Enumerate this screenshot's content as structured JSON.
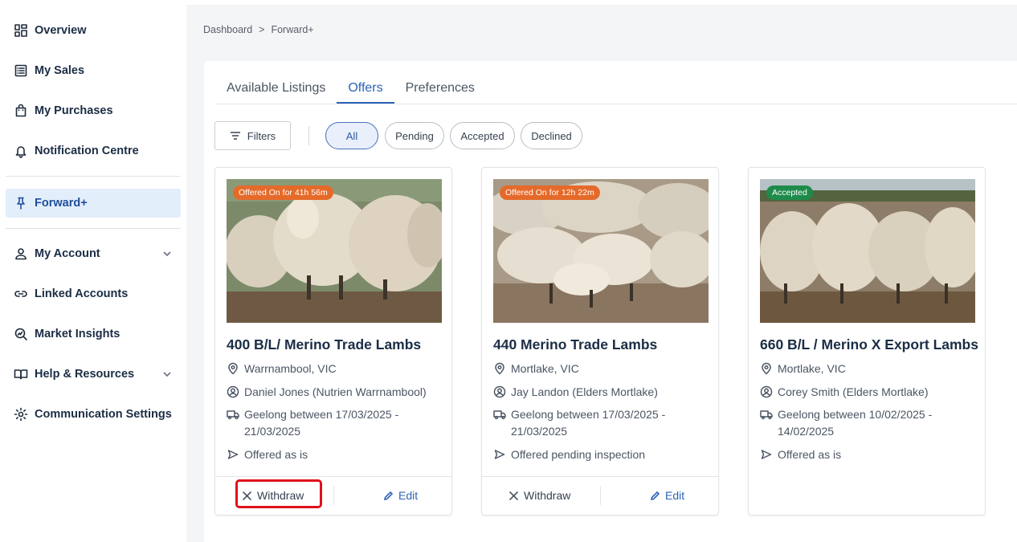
{
  "sidebar": {
    "items": [
      {
        "label": "Overview",
        "icon": "grid-icon"
      },
      {
        "label": "My Sales",
        "icon": "list-icon"
      },
      {
        "label": "My Purchases",
        "icon": "bag-icon"
      },
      {
        "label": "Notification Centre",
        "icon": "bell-icon"
      },
      {
        "label": "Forward+",
        "icon": "pin-icon",
        "active": true
      },
      {
        "label": "My Account",
        "icon": "user-icon",
        "expandable": true
      },
      {
        "label": "Linked Accounts",
        "icon": "link-icon"
      },
      {
        "label": "Market Insights",
        "icon": "insights-icon"
      },
      {
        "label": "Help & Resources",
        "icon": "book-icon",
        "expandable": true
      },
      {
        "label": "Communication Settings",
        "icon": "gear-icon"
      }
    ]
  },
  "breadcrumb": {
    "home": "Dashboard",
    "separator": ">",
    "current": "Forward+"
  },
  "tabs": [
    {
      "label": "Available Listings"
    },
    {
      "label": "Offers",
      "active": true
    },
    {
      "label": "Preferences"
    }
  ],
  "filters": {
    "button_label": "Filters",
    "chips": [
      {
        "label": "All",
        "active": true
      },
      {
        "label": "Pending"
      },
      {
        "label": "Accepted"
      },
      {
        "label": "Declined"
      }
    ]
  },
  "cards": [
    {
      "badge": "Offered On for 41h 56m",
      "badge_color": "#e56a2a",
      "title": "400 B/L/ Merino Trade Lambs",
      "location": "Warrnambool, VIC",
      "agent": "Daniel Jones (Nutrien Warrnambool)",
      "delivery_line1": "Geelong between 17/03/2025 -",
      "delivery_line2": "21/03/2025",
      "terms": "Offered as is",
      "withdraw_label": "Withdraw",
      "edit_label": "Edit"
    },
    {
      "badge": "Offered On for 12h 22m",
      "badge_color": "#e56a2a",
      "title": "440 Merino Trade Lambs",
      "location": "Mortlake, VIC",
      "agent": "Jay Landon (Elders Mortlake)",
      "delivery_line1": "Geelong between 17/03/2025 -",
      "delivery_line2": "21/03/2025",
      "terms": "Offered pending inspection",
      "withdraw_label": "Withdraw",
      "edit_label": "Edit"
    },
    {
      "badge": "Accepted",
      "badge_color": "#1e8b4a",
      "title": "660 B/L / Merino X Export Lambs",
      "location": "Mortlake, VIC",
      "agent": "Corey Smith (Elders Mortlake)",
      "delivery_line1": "Geelong between 10/02/2025 -",
      "delivery_line2": "14/02/2025",
      "terms": "Offered as is"
    }
  ],
  "colors": {
    "accent": "#2c63b7",
    "highlight": "#e0111b",
    "badge_orange": "#e56a2a",
    "badge_green": "#1e8b4a"
  }
}
